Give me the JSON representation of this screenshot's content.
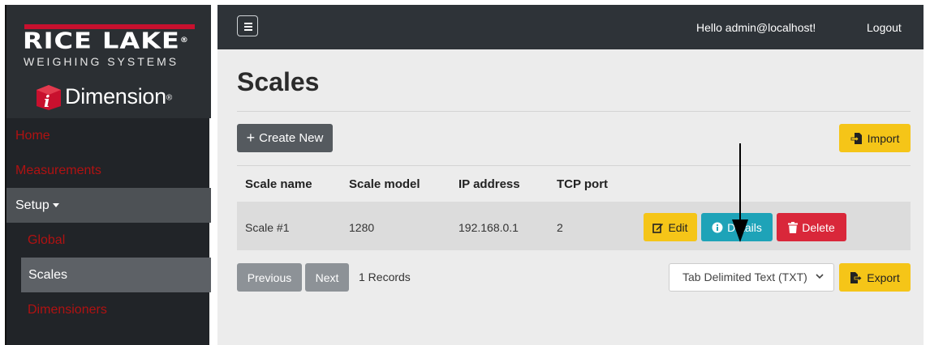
{
  "brand": {
    "company": "RICE LAKE",
    "tagline": "WEIGHING SYSTEMS",
    "product": "Dimension",
    "registered": "®"
  },
  "sidebar": {
    "items": [
      {
        "label": "Home"
      },
      {
        "label": "Measurements"
      },
      {
        "label": "Setup"
      },
      {
        "label": "Global"
      },
      {
        "label": "Scales"
      },
      {
        "label": "Dimensioners"
      }
    ]
  },
  "header": {
    "greeting": "Hello admin@localhost!",
    "logout": "Logout"
  },
  "page": {
    "title": "Scales",
    "create_label": "Create New",
    "import_label": "Import"
  },
  "table": {
    "columns": [
      "Scale name",
      "Scale model",
      "IP address",
      "TCP port"
    ],
    "rows": [
      [
        "Scale #1",
        "1280",
        "192.168.0.1",
        "2"
      ]
    ],
    "actions": {
      "edit": "Edit",
      "details": "Details",
      "delete": "Delete"
    }
  },
  "pagination": {
    "previous": "Previous",
    "next": "Next",
    "records": "1 Records"
  },
  "export": {
    "format": "Tab Delimited Text (TXT)",
    "label": "Export"
  },
  "colors": {
    "brand_red": "#c8102e",
    "warning": "#f5c518",
    "info": "#1ea3b8",
    "danger": "#d9273a"
  }
}
